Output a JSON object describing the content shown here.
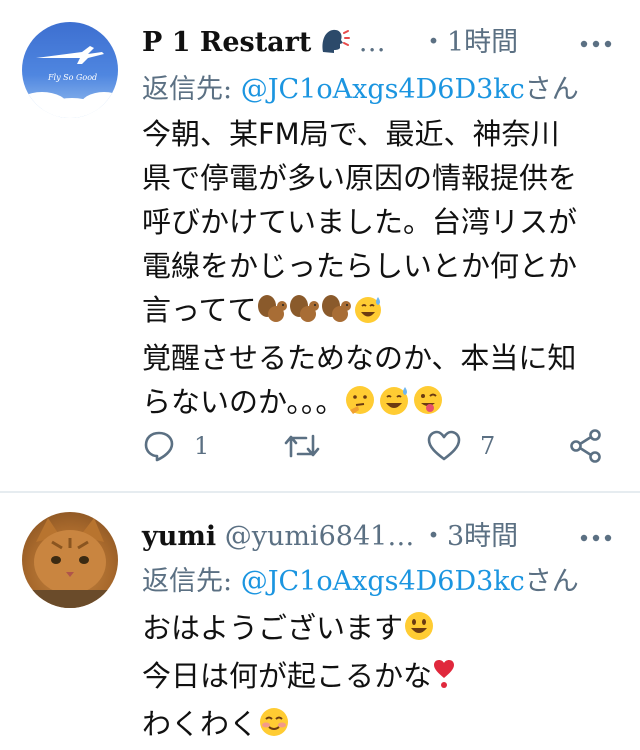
{
  "tweets": [
    {
      "name": "P 1 Restart",
      "handle": "…",
      "time": "・1時間",
      "reply_label": "返信先: ",
      "reply_mention": "@JC1oAxgs4D6D3kc",
      "reply_suffix": "さん",
      "avatar_text": "Fly So Good",
      "lines": [
        "今朝、某FM局で、最近、神奈川",
        "県で停電が多い原因の情報提供を",
        "呼びかけていました。台湾リスが",
        "電線をかじったらしいとか何とか",
        "言ってて",
        "覚醒させるためなのか、本当に知",
        "らないのか。。。"
      ],
      "replies": "1",
      "likes": "7"
    },
    {
      "name": "yumi",
      "handle": "@yumi6841…",
      "time": "・3時間",
      "reply_label": "返信先: ",
      "reply_mention": "@JC1oAxgs4D6D3kc",
      "reply_suffix": "さん",
      "lines": [
        "おはようございます",
        "今日は何が起こるかな",
        "わくわく"
      ]
    }
  ],
  "colors": {
    "accent": "#1b95e0",
    "muted": "#5b7083",
    "divider": "#e6ecf0"
  },
  "icons": [
    "speaking-head-icon",
    "chipmunk-icon",
    "sweat-smile-icon",
    "thinking-face-icon",
    "wink-tongue-icon",
    "smile-icon",
    "heart-exclamation-icon",
    "blush-icon",
    "reply-icon",
    "retweet-icon",
    "like-icon",
    "share-icon",
    "more-icon"
  ]
}
